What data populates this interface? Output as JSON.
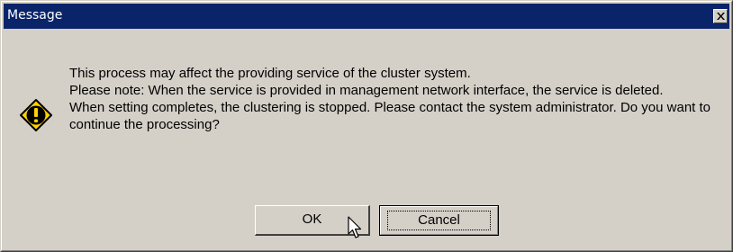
{
  "window": {
    "title": "Message",
    "close_icon": "close-icon"
  },
  "message": {
    "lines": [
      "This process may affect the providing service of the cluster system.",
      "Please note: When the service is provided in management network interface, the service is deleted.",
      "When setting completes, the clustering is stopped. Please contact the system administrator. Do you want to continue the processing?"
    ],
    "icon": "warning-icon"
  },
  "buttons": {
    "ok_label": "OK",
    "cancel_label": "Cancel"
  },
  "colors": {
    "titlebar": "#0a246a",
    "dialog_bg": "#d4d0c8",
    "icon_yellow": "#ffd200"
  }
}
